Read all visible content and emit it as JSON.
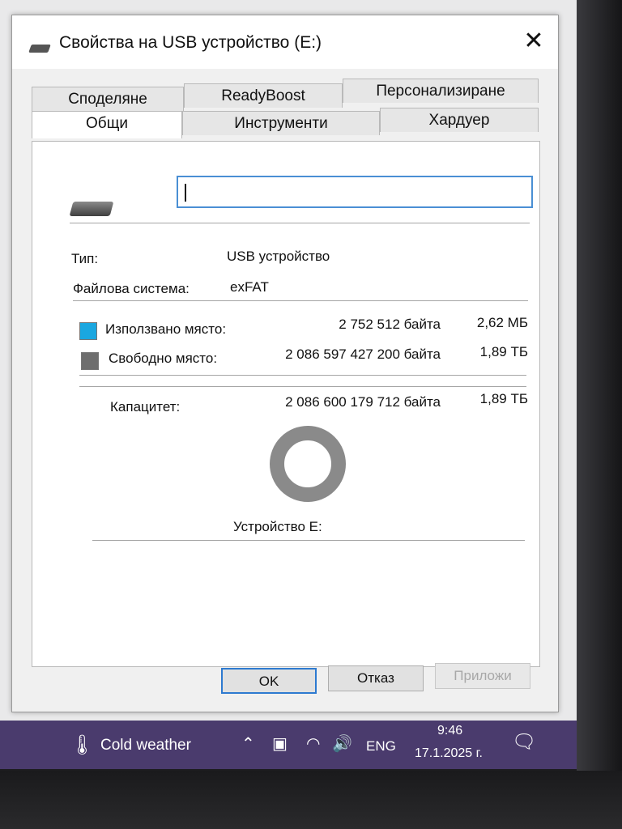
{
  "window": {
    "title": "Свойства на USB устройство (E:)",
    "close_label": "✕"
  },
  "tabs": {
    "row1": [
      "Споделяне",
      "ReadyBoost",
      "Персонализиране"
    ],
    "row2": [
      "Общи",
      "Инструменти",
      "Хардуер"
    ],
    "active": "Общи"
  },
  "general": {
    "name_value": "",
    "type_label": "Тип:",
    "type_value": "USB устройство",
    "fs_label": "Файлова система:",
    "fs_value": "exFAT",
    "used": {
      "label": "Използвано място:",
      "bytes": "2 752 512 байта",
      "size": "2,62 МБ",
      "color": "#1aa7e0"
    },
    "free": {
      "label": "Свободно място:",
      "bytes": "2 086 597 427 200 байта",
      "size": "1,89 ТБ",
      "color": "#6e6e6e"
    },
    "capacity": {
      "label": "Капацитет:",
      "bytes": "2 086 600 179 712 байта",
      "size": "1,89 ТБ"
    },
    "used_fraction": 1.3e-06,
    "drive_label": "Устройство E:"
  },
  "buttons": {
    "ok": "OK",
    "cancel": "Отказ",
    "apply": "Приложи"
  },
  "taskbar": {
    "weather": "Cold weather",
    "language": "ENG",
    "time": "9:46",
    "date": "17.1.2025 г."
  }
}
